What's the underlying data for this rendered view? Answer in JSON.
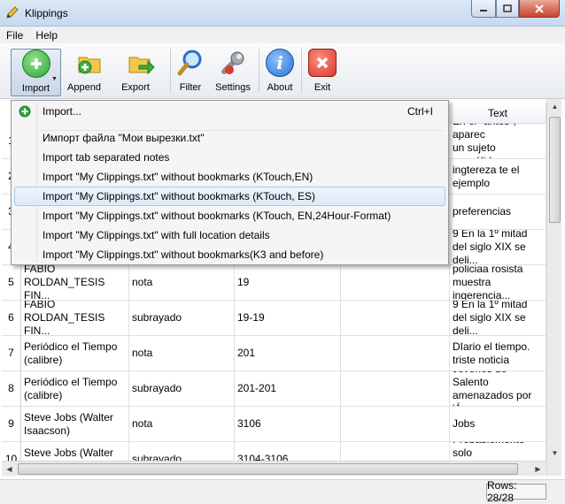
{
  "window": {
    "title": "Klippings"
  },
  "menu": {
    "items": [
      "File",
      "Help"
    ]
  },
  "toolbar": {
    "import": "Import",
    "append": "Append",
    "export": "Export",
    "filter": "Filter",
    "settings": "Settings",
    "about": "About",
    "exit": "Exit"
  },
  "table": {
    "text_header": "Text",
    "rows": [
      {
        "num": "1",
        "book": "",
        "type": "",
        "location": "",
        "date": "",
        "text": "En el \"antes\", aparec\nun sujeto escuálido..."
      },
      {
        "num": "2",
        "book": "",
        "type": "",
        "location": "",
        "date": "",
        "text": "ingtereza te el\nejemplo"
      },
      {
        "num": "3",
        "book": "",
        "type": "",
        "location": "",
        "date": "",
        "text": "preferencias"
      },
      {
        "num": "4",
        "book": "",
        "type": "",
        "location": "",
        "date": "",
        "text": "9      En la 1º mitad\ndel siglo XIX se deli..."
      },
      {
        "num": "5",
        "book": "FABIO\nROLDAN_TESIS FIN...",
        "type": "nota",
        "location": "19",
        "date": "",
        "text": "policiaa rosista\nmuestra ingerencia..."
      },
      {
        "num": "6",
        "book": "FABIO\nROLDAN_TESIS FIN...",
        "type": "subrayado",
        "location": "19-19",
        "date": "",
        "text": "9      En la 1º mitad\ndel siglo XIX se deli..."
      },
      {
        "num": "7",
        "book": "Periódico el Tiempo\n(calibre)",
        "type": "nota",
        "location": "201",
        "date": "",
        "text": "DIario el tiempo.\ntriste noticia"
      },
      {
        "num": "8",
        "book": "Periódico el Tiempo\n(calibre)",
        "type": "subrayado",
        "location": "201-201",
        "date": "",
        "text": "Jóvenes de Salento\namenazados por 'Á..."
      },
      {
        "num": "9",
        "book": "Steve Jobs (Walter\nIsaacson)",
        "type": "nota",
        "location": "3106",
        "date": "",
        "text": "Jobs"
      },
      {
        "num": "10",
        "book": "Steve Jobs (Walter\nIsaacson)",
        "type": "subrayado",
        "location": "3104-3106",
        "date": "",
        "text": "Probablemente solo\nlos productos de Ap..."
      }
    ]
  },
  "import_menu": {
    "items": [
      {
        "label": "Import...",
        "shortcut": "Ctrl+I"
      },
      {
        "label": "Импорт файла \"Мои вырезки.txt\"",
        "shortcut": ""
      },
      {
        "label": "Import tab separated notes",
        "shortcut": ""
      },
      {
        "label": "Import \"My Clippings.txt\" without bookmarks (KTouch,EN)",
        "shortcut": ""
      },
      {
        "label": "Import \"My Clippings.txt\" without bookmarks (KTouch, ES)",
        "shortcut": ""
      },
      {
        "label": "Import \"My Clippings.txt\" without bookmarks (KTouch, EN,24Hour-Format)",
        "shortcut": ""
      },
      {
        "label": "Import \"My Clippings.txt\" with full location details",
        "shortcut": ""
      },
      {
        "label": "Import \"My Clippings.txt\" without bookmarks(K3 and before)",
        "shortcut": ""
      }
    ],
    "highlighted_index": 4
  },
  "status": {
    "rows": "Rows: 28/28"
  },
  "colors": {
    "accent": "#3399ff",
    "import_green": "#2fa63a",
    "exit_red": "#d83a2e",
    "about_blue": "#2a6fd0"
  }
}
